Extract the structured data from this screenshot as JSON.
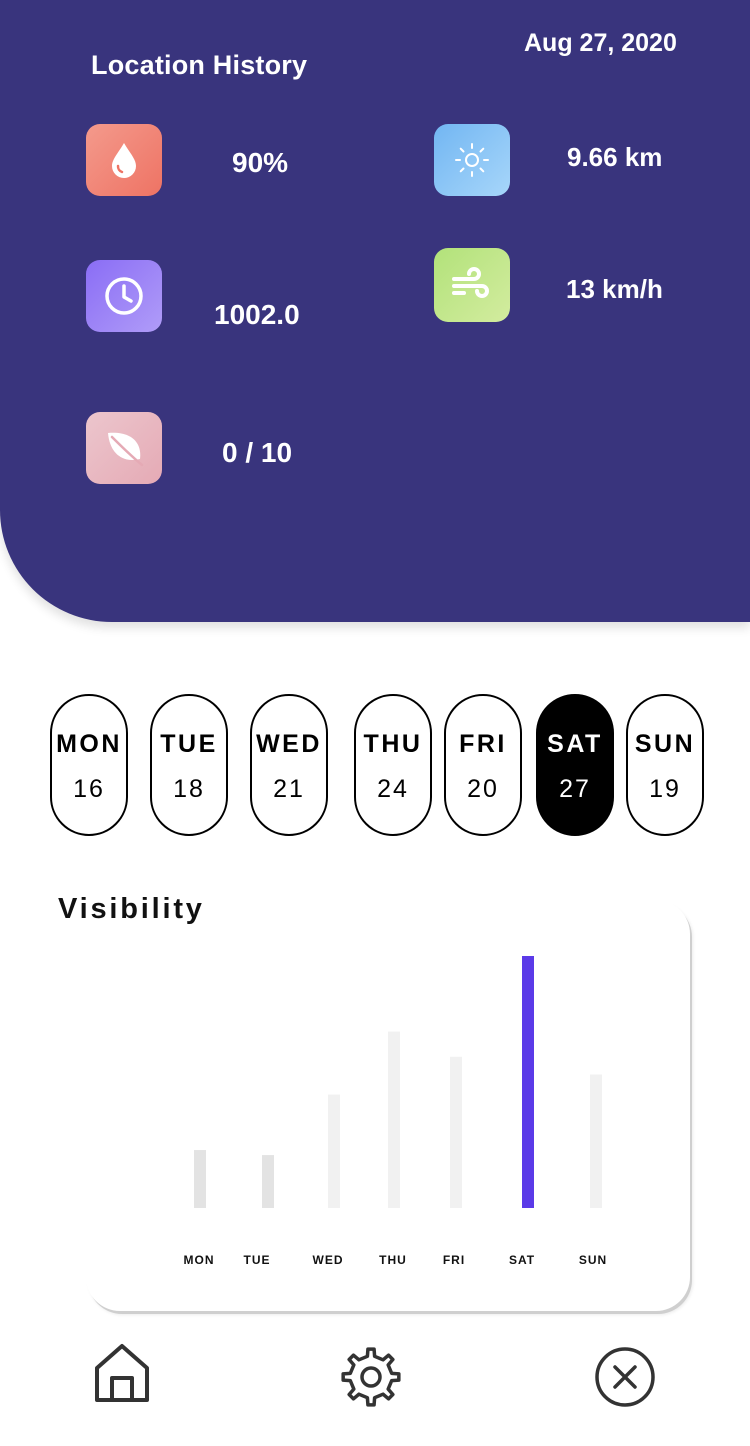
{
  "header": {
    "title": "Location History",
    "date": "Aug 27, 2020"
  },
  "metrics": {
    "humidity": {
      "icon": "water-drop-icon",
      "value": "90%"
    },
    "pressure": {
      "icon": "clock-icon",
      "value": "1002.0"
    },
    "uv_index": {
      "icon": "leaf-icon",
      "value": "0 / 10"
    },
    "visibility": {
      "icon": "sun-icon",
      "value": "9.66 km"
    },
    "wind": {
      "icon": "wind-icon",
      "value": "13 km/h"
    }
  },
  "days": [
    {
      "name": "MON",
      "num": "16",
      "active": false
    },
    {
      "name": "TUE",
      "num": "18",
      "active": false
    },
    {
      "name": "WED",
      "num": "21",
      "active": false
    },
    {
      "name": "THU",
      "num": "24",
      "active": false
    },
    {
      "name": "FRI",
      "num": "20",
      "active": false
    },
    {
      "name": "SAT",
      "num": "27",
      "active": true
    },
    {
      "name": "SUN",
      "num": "19",
      "active": false
    }
  ],
  "chart_data": {
    "type": "bar",
    "title": "Visibility",
    "categories": [
      "MON",
      "TUE",
      "WED",
      "THU",
      "FRI",
      "SAT",
      "SUN"
    ],
    "values": [
      23,
      21,
      45,
      70,
      60,
      100,
      53
    ],
    "highlight_index": 5,
    "colors": {
      "highlight": "#5b3ae8",
      "muted_dark": "#e3e3e3",
      "muted_light": "#f1f1f1"
    },
    "grid": false,
    "legend": "none"
  },
  "nav": {
    "home_icon": "home-icon",
    "settings_icon": "gear-icon",
    "close_icon": "close-circle-icon"
  },
  "colors": {
    "header_bg": "#39347d",
    "accent": "#5b3ae8"
  }
}
